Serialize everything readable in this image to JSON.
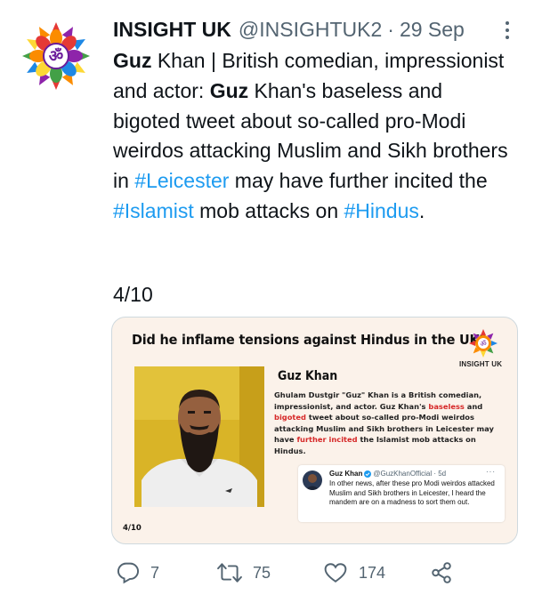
{
  "tweet": {
    "display_name": "INSIGHT UK",
    "handle": "@INSIGHTUK2",
    "separator": "·",
    "date": "29 Sep",
    "body": {
      "lead_bold": "Guz",
      "lead_rest": " Khan | British comedian, impressionist and actor:  ",
      "name_bold": "Guz",
      "text_1": " Khan's baseless and bigoted tweet about so-called pro-Modi weirdos attacking Muslim and Sikh brothers in ",
      "hashtag_1": "#Leicester",
      "text_2": " may have further incited the ",
      "hashtag_2": "#Islamist",
      "text_3": " mob attacks on ",
      "hashtag_3": "#Hindus",
      "text_4": "."
    },
    "counter": "4/10"
  },
  "card": {
    "headline": "Did he inflame tensions against Hindus in the UK?",
    "logo_text": "INSIGHT UK",
    "person_name": "Guz Khan",
    "desc": {
      "p1": "Ghulam Dustgir \"Guz\" Khan is a British comedian, impressionist, and actor. Guz Khan's ",
      "red1": "baseless",
      "p2": " and ",
      "red2": "bigoted",
      "p3": " tweet about so-called pro-Modi weirdos attacking Muslim and Sikh brothers in Leicester may have ",
      "red3": "further incited",
      "p4": " the Islamist mob attacks on Hindus."
    },
    "embed": {
      "name": "Guz Khan",
      "handle_time": "@GuzKhanOfficial · 5d",
      "more": "···",
      "text": "In other news, after these pro Modi weirdos attacked Muslim and Sikh brothers in Leicester, I heard the mandem are on a madness to sort them out."
    },
    "count": "4/10"
  },
  "actions": {
    "reply_count": "7",
    "retweet_count": "75",
    "like_count": "174"
  },
  "colors": {
    "link": "#1d9bf0",
    "muted": "#536471",
    "text": "#0f1419",
    "card_bg": "#fbf2ea",
    "highlight_red": "#d62828"
  },
  "icons": {
    "avatar": "om-mandala-logo",
    "more": "more-dots-icon",
    "reply": "reply-icon",
    "retweet": "retweet-icon",
    "like": "heart-icon",
    "share": "share-icon"
  }
}
